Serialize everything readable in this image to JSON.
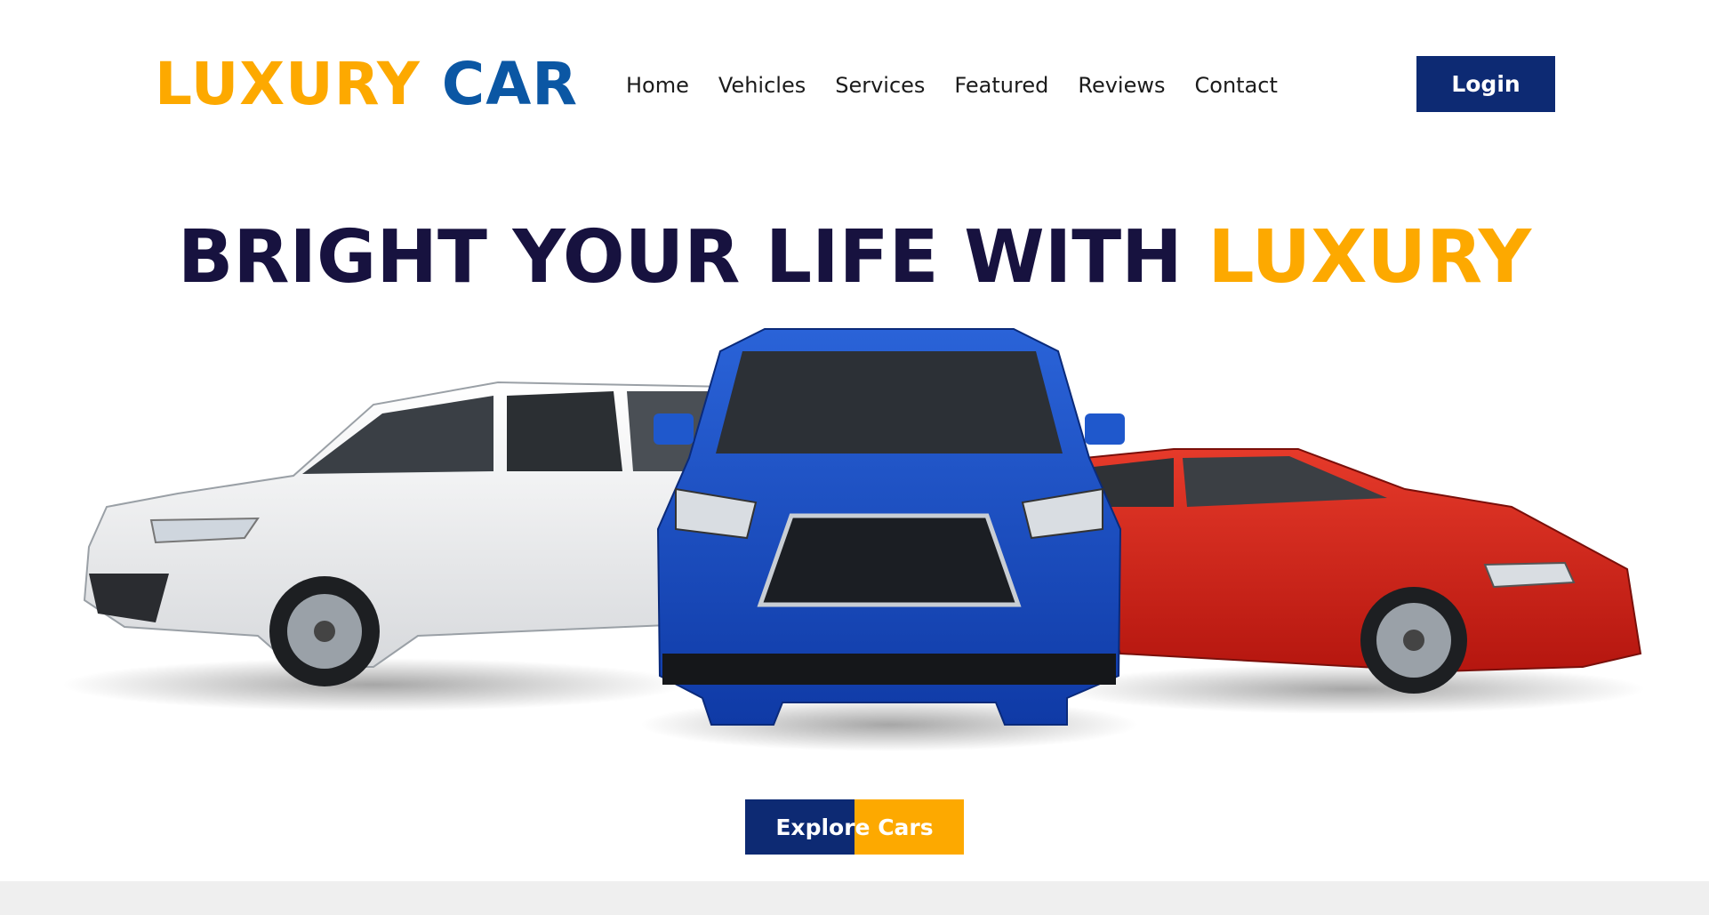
{
  "brand": {
    "part1": "LUXURY",
    "part2": "CAR"
  },
  "nav": {
    "items": [
      {
        "label": "Home"
      },
      {
        "label": "Vehicles"
      },
      {
        "label": "Services"
      },
      {
        "label": "Featured"
      },
      {
        "label": "Reviews"
      },
      {
        "label": "Contact"
      }
    ],
    "login_label": "Login"
  },
  "hero": {
    "title_main": "BRIGHT YOUR LIFE WITH ",
    "title_accent": "LUXURY",
    "cta_label": "Explore Cars"
  },
  "colors": {
    "accent_orange": "#fda900",
    "brand_blue": "#0b57a4",
    "navy": "#0d2a73",
    "title_dark": "#17123f"
  }
}
